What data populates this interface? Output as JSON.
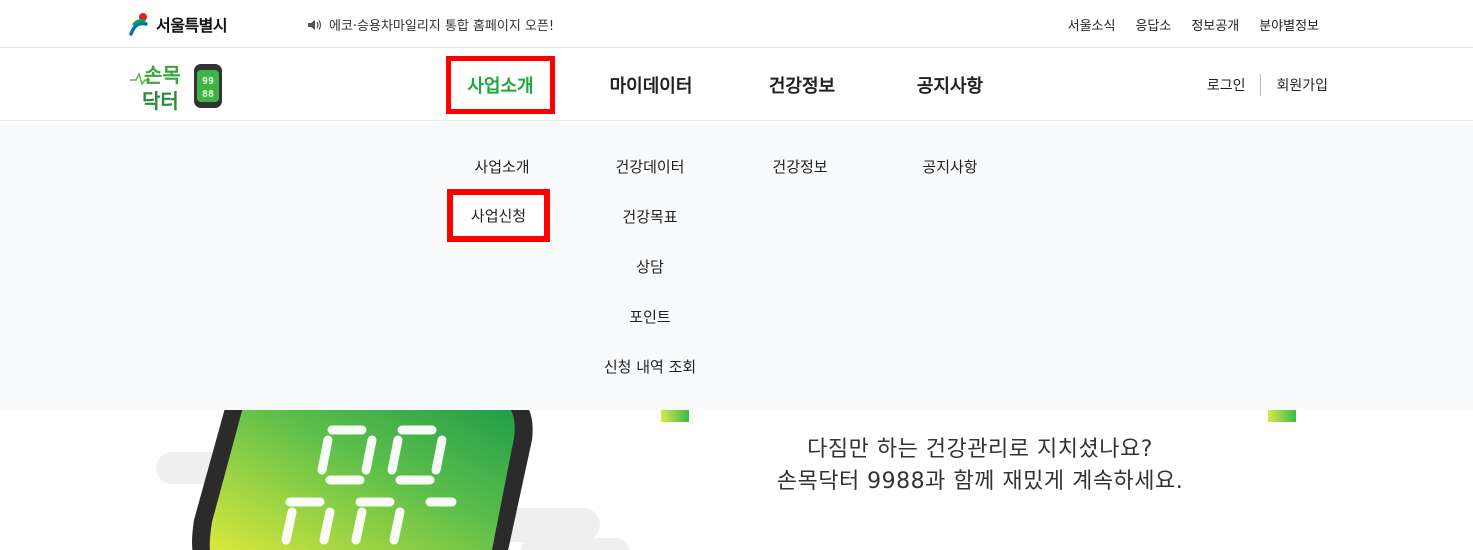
{
  "topbar": {
    "seoul_label": "서울특별시",
    "notice": "에코·승용차마일리지 통합 홈페이지 오픈!",
    "utils": [
      "서울소식",
      "응답소",
      "정보공개",
      "분야별정보"
    ]
  },
  "brand": {
    "line1": "손목",
    "line2": "닥터",
    "badge": "99 88"
  },
  "nav": {
    "items": [
      "사업소개",
      "마이데이터",
      "건강정보",
      "공지사항"
    ],
    "login": "로그인",
    "join": "회원가입"
  },
  "mega": {
    "col1": [
      "사업소개",
      "사업신청"
    ],
    "col2": [
      "건강데이터",
      "건강목표",
      "상담",
      "포인트",
      "신청 내역 조회"
    ],
    "col3": [
      "건강정보"
    ],
    "col4": [
      "공지사항"
    ]
  },
  "hero": {
    "line1": "다짐만 하는 건강관리로 지치셨나요?",
    "line2": "손목닥터 9988과 함께 재밌게 계속하세요."
  },
  "colors": {
    "accent_green": "#1ea83b",
    "highlight_red": "#ff0000",
    "dropdown_bg": "#f9fafb"
  }
}
